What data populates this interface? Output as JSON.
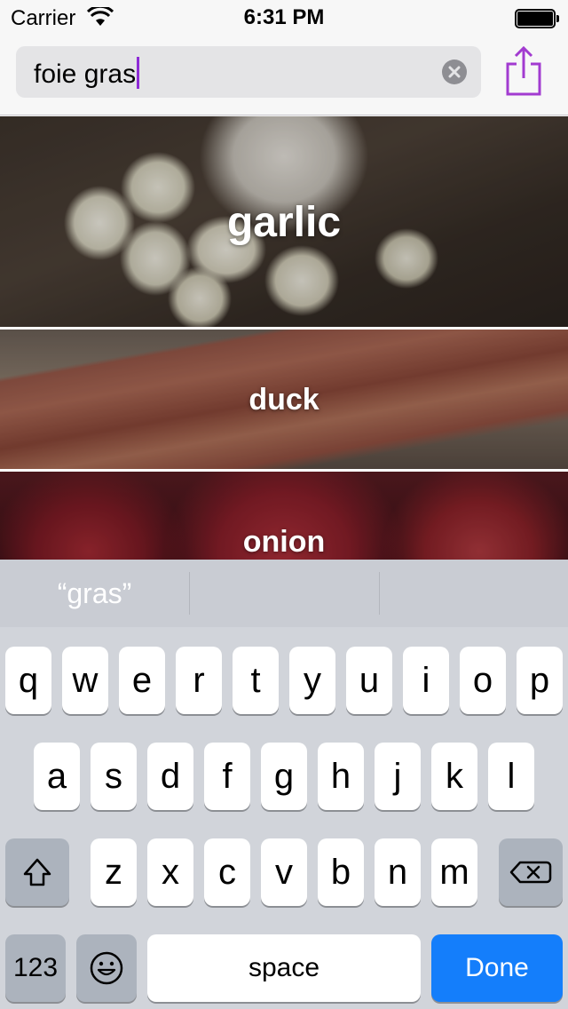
{
  "status_bar": {
    "carrier": "Carrier",
    "time": "6:31 PM"
  },
  "search": {
    "value": "foie gras"
  },
  "colors": {
    "caret": "#8e2bd6",
    "share_icon": "#a23bd0",
    "done_key": "#147efb"
  },
  "ingredients": [
    {
      "name": "garlic"
    },
    {
      "name": "duck"
    },
    {
      "name": "onion"
    }
  ],
  "keyboard": {
    "suggestions": [
      "“gras”",
      "",
      ""
    ],
    "row1": [
      "q",
      "w",
      "e",
      "r",
      "t",
      "y",
      "u",
      "i",
      "o",
      "p"
    ],
    "row2": [
      "a",
      "s",
      "d",
      "f",
      "g",
      "h",
      "j",
      "k",
      "l"
    ],
    "row3": [
      "z",
      "x",
      "c",
      "v",
      "b",
      "n",
      "m"
    ],
    "numbers_label": "123",
    "space_label": "space",
    "done_label": "Done",
    "icons": [
      "shift-icon",
      "backspace-icon",
      "emoji-icon"
    ]
  }
}
